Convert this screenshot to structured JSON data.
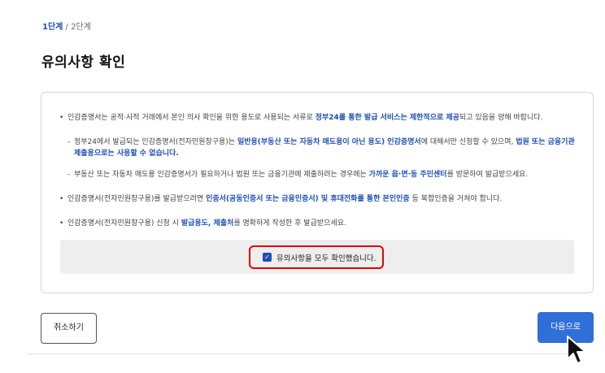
{
  "steps": {
    "current": "1단계",
    "separator": " / ",
    "next": "2단계"
  },
  "page_title": "유의사항 확인",
  "notices": {
    "item1": {
      "t1": "인감증명서는 공적·사적 거래에서 본인 의사 확인을 위한 용도로 사용되는 서류로 ",
      "h1": "정부24를 통한 발급 서비스는 제한적으로 제공",
      "t2": "되고 있음을 양해 바랍니다."
    },
    "sub1": {
      "t1": "정부24에서 발급되는 인감증명서(전자민원창구용)는 ",
      "h1": "일반용(부동산 또는 자동차 매도용이 아닌 용도) 인감증명서",
      "t2": "에 대해서만 신청할 수 있으며, ",
      "h2": "법원 또는 금융기관 제출용으로는 사용할 수 없습니다."
    },
    "sub2": {
      "t1": "부동산 또는 자동차 매도용 인감증명서가 필요하거나 법원 또는 금융기관에 제출하려는 경우에는 ",
      "h1": "가까운 읍·면·동 주민센터",
      "t2": "를 방문하여 발급받으세요."
    },
    "item2": {
      "t1": "인감증명서(전자민원창구용)를 발급받으려면 ",
      "h1": "인증서(공동인증서 또는 금융인증서) 및 휴대전화를 통한 본인인증",
      "t2": " 등 복합인증을 거쳐야 합니다."
    },
    "item3": {
      "t1": "인감증명서(전자민원창구용) 신청 시 ",
      "h1": "발급용도, 제출처",
      "t2": "를 명확하게 작성한 후 발급받으세요."
    }
  },
  "confirm": {
    "label": "유의사항을 모두 확인했습니다.",
    "checked": true
  },
  "buttons": {
    "cancel": "취소하기",
    "next": "다음으로"
  },
  "colors": {
    "accent": "#1f4fb5",
    "primary_button": "#2f6fd8",
    "highlight_outline": "#e60000"
  }
}
